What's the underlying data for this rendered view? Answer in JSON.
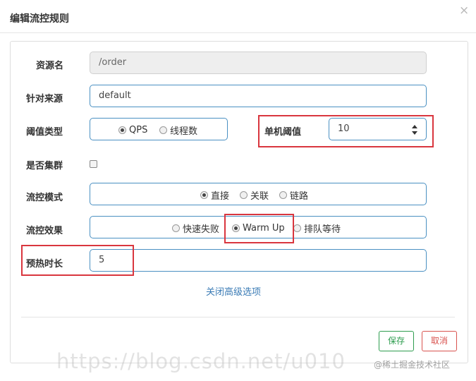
{
  "dialog": {
    "title": "编辑流控规则",
    "close_glyph": "×"
  },
  "fields": {
    "resource": {
      "label": "资源名",
      "value": "/order"
    },
    "limit_app": {
      "label": "针对来源",
      "value": "default"
    },
    "grade": {
      "label": "阈值类型",
      "options": [
        {
          "label": "QPS",
          "checked": true
        },
        {
          "label": "线程数",
          "checked": false
        }
      ]
    },
    "count": {
      "label": "单机阈值",
      "value": "10"
    },
    "cluster": {
      "label": "是否集群",
      "checked": false
    },
    "strategy": {
      "label": "流控模式",
      "options": [
        {
          "label": "直接",
          "checked": true
        },
        {
          "label": "关联",
          "checked": false
        },
        {
          "label": "链路",
          "checked": false
        }
      ]
    },
    "control_behavior": {
      "label": "流控效果",
      "options": [
        {
          "label": "快速失败",
          "checked": false
        },
        {
          "label": "Warm Up",
          "checked": true
        },
        {
          "label": "排队等待",
          "checked": false
        }
      ]
    },
    "warm_up_period": {
      "label": "预热时长",
      "value": "5"
    }
  },
  "advanced_toggle": "关闭高级选项",
  "footer": {
    "save_label": "保存",
    "cancel_label": "取消"
  },
  "watermark": {
    "url_text": "https://blog.csdn.net/u010",
    "source": "@稀土掘金技术社区"
  },
  "colors": {
    "input_border": "#4a90c2",
    "highlight": "#d9363e",
    "save": "#2e9d4f",
    "cancel": "#d9534f",
    "link": "#3a7bb5"
  }
}
